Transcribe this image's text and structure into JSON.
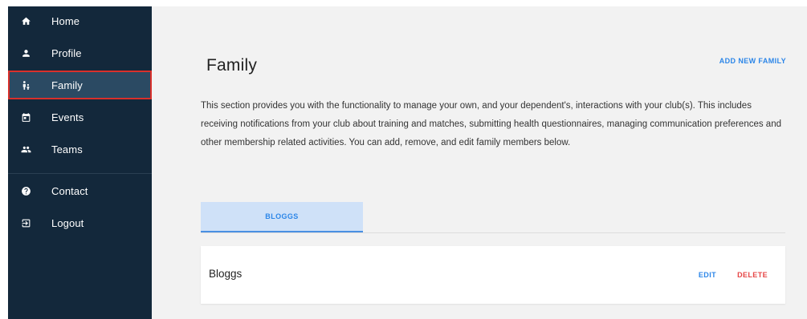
{
  "sidebar": {
    "items": [
      {
        "label": "Home",
        "icon": "home-icon"
      },
      {
        "label": "Profile",
        "icon": "person-icon"
      },
      {
        "label": "Family",
        "icon": "family-icon",
        "active": true
      },
      {
        "label": "Events",
        "icon": "calendar-icon"
      },
      {
        "label": "Teams",
        "icon": "group-icon"
      },
      {
        "label": "Contact",
        "icon": "help-icon"
      },
      {
        "label": "Logout",
        "icon": "logout-icon"
      }
    ]
  },
  "main": {
    "title": "Family",
    "add_label": "ADD NEW FAMILY",
    "description": "This section provides you with the functionality to manage your own, and your dependent's, interactions with your club(s). This includes receiving notifications from your club about training and matches, submitting health questionnaires, managing communication preferences and other membership related activities. You can add, remove, and edit family members below.",
    "tabs": [
      {
        "label": "BLOGGS",
        "active": true
      }
    ],
    "family_card": {
      "name": "Bloggs",
      "edit_label": "EDIT",
      "delete_label": "DELETE"
    }
  },
  "colors": {
    "sidebar_bg": "#13283b",
    "active_item_bg": "#2b4a63",
    "highlight_outline": "#d9302b",
    "accent_blue": "#2c86e8",
    "delete_red": "#e64545",
    "content_bg": "#f2f2f2"
  }
}
